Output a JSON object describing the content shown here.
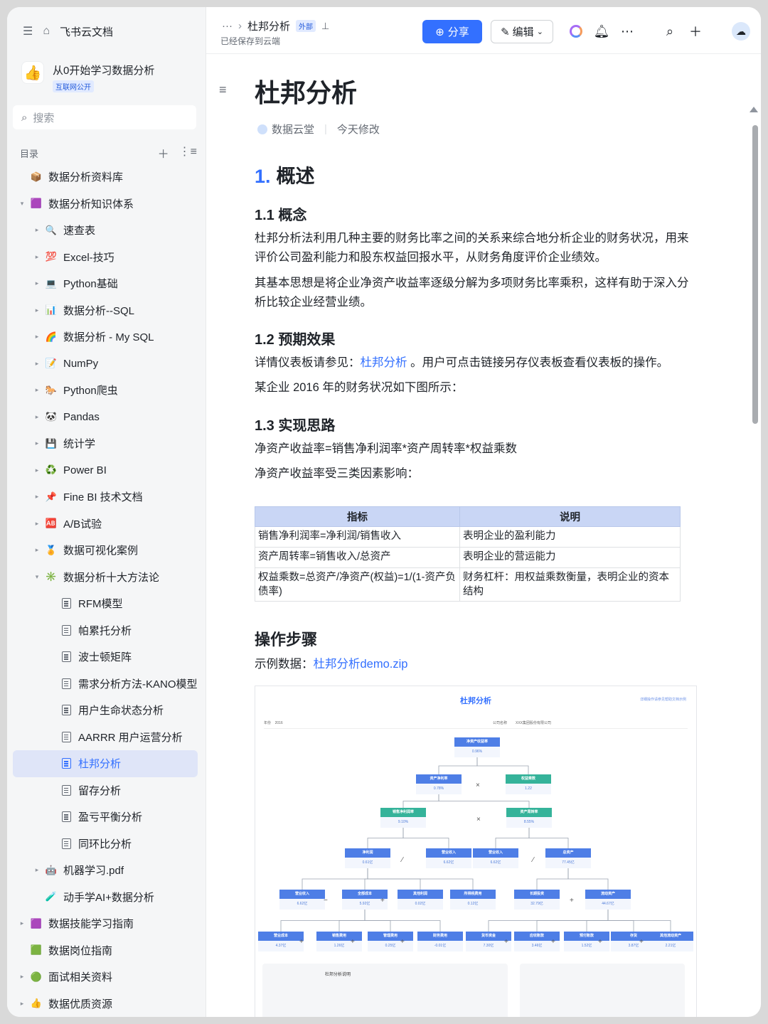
{
  "sidebar": {
    "home_label": "飞书云文档",
    "space_title": "从0开始学习数据分析",
    "space_badge": "互联网公开",
    "search_placeholder": "搜索",
    "toc_label": "目录",
    "items": [
      {
        "label": "数据分析资料库",
        "icon": "📦"
      },
      {
        "label": "数据分析知识体系",
        "icon": "🟪"
      },
      {
        "label": "速查表",
        "icon": "🔍"
      },
      {
        "label": "Excel-技巧",
        "icon": "💯"
      },
      {
        "label": "Python基础",
        "icon": "💻"
      },
      {
        "label": "数据分析--SQL",
        "icon": "📊"
      },
      {
        "label": "数据分析 - My SQL",
        "icon": "🌈"
      },
      {
        "label": "NumPy",
        "icon": "📝"
      },
      {
        "label": "Python爬虫",
        "icon": "🐎"
      },
      {
        "label": "Pandas",
        "icon": "🐼"
      },
      {
        "label": "统计学",
        "icon": "💾"
      },
      {
        "label": "Power BI",
        "icon": "♻️"
      },
      {
        "label": "Fine BI 技术文档",
        "icon": "📌"
      },
      {
        "label": "A/B试验",
        "icon": "🆎"
      },
      {
        "label": "数据可视化案例",
        "icon": "🏅"
      },
      {
        "label": "数据分析十大方法论",
        "icon": "✳️"
      },
      {
        "label": "RFM模型",
        "icon": "doc"
      },
      {
        "label": "帕累托分析",
        "icon": "doc"
      },
      {
        "label": "波士顿矩阵",
        "icon": "doc"
      },
      {
        "label": "需求分析方法-KANO模型",
        "icon": "doc"
      },
      {
        "label": "用户生命状态分析",
        "icon": "doc"
      },
      {
        "label": "AARRR 用户运营分析",
        "icon": "doc"
      },
      {
        "label": "杜邦分析",
        "icon": "doc"
      },
      {
        "label": "留存分析",
        "icon": "doc"
      },
      {
        "label": "盈亏平衡分析",
        "icon": "doc"
      },
      {
        "label": "同环比分析",
        "icon": "doc"
      },
      {
        "label": "机器学习.pdf",
        "icon": "🤖"
      },
      {
        "label": "动手学AI+数据分析",
        "icon": "🧪"
      },
      {
        "label": "数据技能学习指南",
        "icon": "🟪"
      },
      {
        "label": "数据岗位指南",
        "icon": "🟩"
      },
      {
        "label": "面试相关资料",
        "icon": "🟢"
      },
      {
        "label": "数据优质资源",
        "icon": "👍"
      }
    ]
  },
  "topbar": {
    "breadcrumb_more": "···",
    "doc_name": "杜邦分析",
    "external_tag": "外部",
    "saved_status": "已经保存到云端",
    "share_label": "分享",
    "edit_label": "编辑"
  },
  "doc": {
    "title": "杜邦分析",
    "author": "数据云堂",
    "modified": "今天修改",
    "section1_num": "1.",
    "section1_title": "概述",
    "h_1_1": "1.1 概念",
    "p_1_1a": "杜邦分析法利用几种主要的财务比率之间的关系来综合地分析企业的财务状况，用来评价公司盈利能力和股东权益回报水平，从财务角度评价企业绩效。",
    "p_1_1b": "其基本思想是将企业净资产收益率逐级分解为多项财务比率乘积，这样有助于深入分析比较企业经营业绩。",
    "h_1_2": "1.2 预期效果",
    "p_1_2a_pre": "详情仪表板请参见：",
    "p_1_2a_link": "杜邦分析",
    "p_1_2a_post": " 。用户可点击链接另存仪表板查看仪表板的操作。",
    "p_1_2b": "某企业 2016 年的财务状况如下图所示：",
    "h_1_3": "1.3 实现思路",
    "p_1_3a": "净资产收益率=销售净利润率*资产周转率*权益乘数",
    "p_1_3b": "净资产收益率受三类因素影响：",
    "table": {
      "headers": [
        "指标",
        "说明"
      ],
      "rows": [
        [
          "销售净利润率=净利润/销售收入",
          "表明企业的盈利能力"
        ],
        [
          "资产周转率=销售收入/总资产",
          "表明企业的营运能力"
        ],
        [
          "权益乘数=总资产/净资产(权益)=1/(1-资产负债率)",
          "财务杠杆：用权益乘数衡量，表明企业的资本结构"
        ]
      ]
    },
    "h_steps": "操作步骤",
    "example_pre": "示例数据：",
    "example_link": "杜邦分析demo.zip"
  },
  "dashboard": {
    "title": "杜邦分析",
    "top_link": "详细操作请参见帮助文档示例",
    "filter_year_label": "年份",
    "filter_year": "2016",
    "filter_company_label": "公司名称",
    "filter_company": "XXX集团股份有限公司",
    "nodes": [
      {
        "label": "净资产收益率",
        "value": "0.96%",
        "color": "blue"
      },
      {
        "label": "资产净利率",
        "value": "0.78%",
        "color": "blue"
      },
      {
        "label": "权益乘数",
        "value": "1.22",
        "color": "green"
      },
      {
        "label": "销售净利润率",
        "value": "9.10%",
        "color": "green"
      },
      {
        "label": "资产周转率",
        "value": "8.55%",
        "color": "green"
      },
      {
        "label": "净利润",
        "value": "0.61亿",
        "color": "blue"
      },
      {
        "label": "营业收入",
        "value": "6.62亿",
        "color": "blue"
      },
      {
        "label": "营业收入",
        "value": "6.62亿",
        "color": "blue"
      },
      {
        "label": "总资产",
        "value": "77.45亿",
        "color": "blue"
      },
      {
        "label": "营业收入",
        "value": "6.62亿",
        "color": "blue"
      },
      {
        "label": "全部成本",
        "value": "5.92亿",
        "color": "blue"
      },
      {
        "label": "其他利润",
        "value": "0.02亿",
        "color": "blue"
      },
      {
        "label": "所得税费用",
        "value": "0.12亿",
        "color": "blue"
      },
      {
        "label": "长期投资",
        "value": "32.79亿",
        "color": "blue"
      },
      {
        "label": "流动资产",
        "value": "44.67亿",
        "color": "blue"
      },
      {
        "label": "营业成本",
        "value": "4.37亿",
        "color": "blue"
      },
      {
        "label": "销售费用",
        "value": "1.26亿",
        "color": "blue"
      },
      {
        "label": "管理费用",
        "value": "0.25亿",
        "color": "blue"
      },
      {
        "label": "财务费用",
        "value": "-0.01亿",
        "color": "blue"
      },
      {
        "label": "货币资金",
        "value": "7.30亿",
        "color": "blue"
      },
      {
        "label": "应收账款",
        "value": "3.46亿",
        "color": "blue"
      },
      {
        "label": "预付账款",
        "value": "1.52亿",
        "color": "blue"
      },
      {
        "label": "存货",
        "value": "3.87亿",
        "color": "blue"
      },
      {
        "label": "其他流动资产",
        "value": "2.21亿",
        "color": "blue"
      }
    ],
    "foot_title": "杜邦分析说明"
  }
}
